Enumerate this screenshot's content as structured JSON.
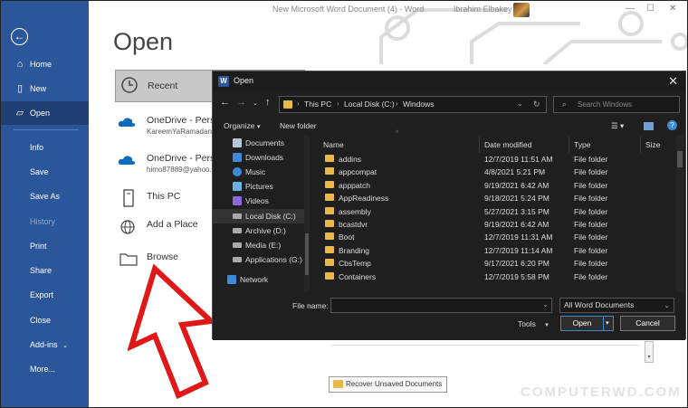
{
  "window": {
    "title": "New Microsoft Word Document (4) - Word",
    "user_name": "Ibrahim Elbakey"
  },
  "rail": {
    "back_icon": "back-arrow-icon",
    "items": [
      {
        "label": "Home",
        "icon": "home-icon"
      },
      {
        "label": "New",
        "icon": "new-document-icon"
      },
      {
        "label": "Open",
        "icon": "folder-open-icon",
        "active": true
      },
      {
        "label": "Info"
      },
      {
        "label": "Save"
      },
      {
        "label": "Save As"
      },
      {
        "label": "History",
        "disabled": true
      },
      {
        "label": "Print"
      },
      {
        "label": "Share"
      },
      {
        "label": "Export"
      },
      {
        "label": "Close"
      },
      {
        "label": "Add-ins",
        "has_dropdown": true
      },
      {
        "label": "More..."
      }
    ]
  },
  "main": {
    "title": "Open",
    "locations": [
      {
        "label": "Recent",
        "icon": "clock-icon"
      },
      {
        "label": "OneDrive - Perso",
        "sub": "KareemYaRamadan",
        "icon": "onedrive-cloud-icon"
      },
      {
        "label": "OneDrive - Perso",
        "sub": "himo87889@yahoo.",
        "icon": "onedrive-cloud-icon"
      },
      {
        "label": "This PC",
        "icon": "computer-icon"
      },
      {
        "label": "Add a Place",
        "icon": "globe-plus-icon"
      },
      {
        "label": "Browse",
        "icon": "folder-icon"
      }
    ],
    "recover_button": "Recover Unsaved Documents",
    "watermark": "COMPUTERWD.COM"
  },
  "dialog": {
    "title": "Open",
    "breadcrumb": [
      "This PC",
      "Local Disk (C:)",
      "Windows"
    ],
    "search_placeholder": "Search Windows",
    "organize": "Organize",
    "new_folder": "New folder",
    "nav_items": [
      {
        "label": "Documents",
        "icon": "documents-icon"
      },
      {
        "label": "Downloads",
        "icon": "downloads-icon"
      },
      {
        "label": "Music",
        "icon": "music-icon"
      },
      {
        "label": "Pictures",
        "icon": "pictures-icon"
      },
      {
        "label": "Videos",
        "icon": "videos-icon"
      },
      {
        "label": "Local Disk (C:)",
        "icon": "drive-icon",
        "selected": true
      },
      {
        "label": "Archive (D:)",
        "icon": "drive-icon"
      },
      {
        "label": "Media (E:)",
        "icon": "drive-icon"
      },
      {
        "label": "Applications (G:)",
        "icon": "drive-icon"
      },
      {
        "label": "Network",
        "icon": "network-icon"
      }
    ],
    "columns": [
      "Name",
      "Date modified",
      "Type",
      "Size"
    ],
    "files": [
      {
        "name": "addins",
        "date": "12/7/2019 11:51 AM",
        "type": "File folder"
      },
      {
        "name": "appcompat",
        "date": "4/8/2021 5:21 PM",
        "type": "File folder"
      },
      {
        "name": "apppatch",
        "date": "9/19/2021 6:42 AM",
        "type": "File folder"
      },
      {
        "name": "AppReadiness",
        "date": "9/18/2021 5:24 PM",
        "type": "File folder"
      },
      {
        "name": "assembly",
        "date": "5/27/2021 3:15 PM",
        "type": "File folder"
      },
      {
        "name": "bcastdvr",
        "date": "9/19/2021 6:42 AM",
        "type": "File folder"
      },
      {
        "name": "Boot",
        "date": "12/7/2019 11:31 AM",
        "type": "File folder"
      },
      {
        "name": "Branding",
        "date": "12/7/2019 11:14 AM",
        "type": "File folder"
      },
      {
        "name": "CbsTemp",
        "date": "9/17/2021 6:20 PM",
        "type": "File folder"
      },
      {
        "name": "Containers",
        "date": "12/7/2019 5:58 PM",
        "type": "File folder"
      }
    ],
    "file_name_label": "File name:",
    "file_name_value": "",
    "file_type": "All Word Documents",
    "tools": "Tools",
    "open_button": "Open",
    "cancel_button": "Cancel"
  }
}
